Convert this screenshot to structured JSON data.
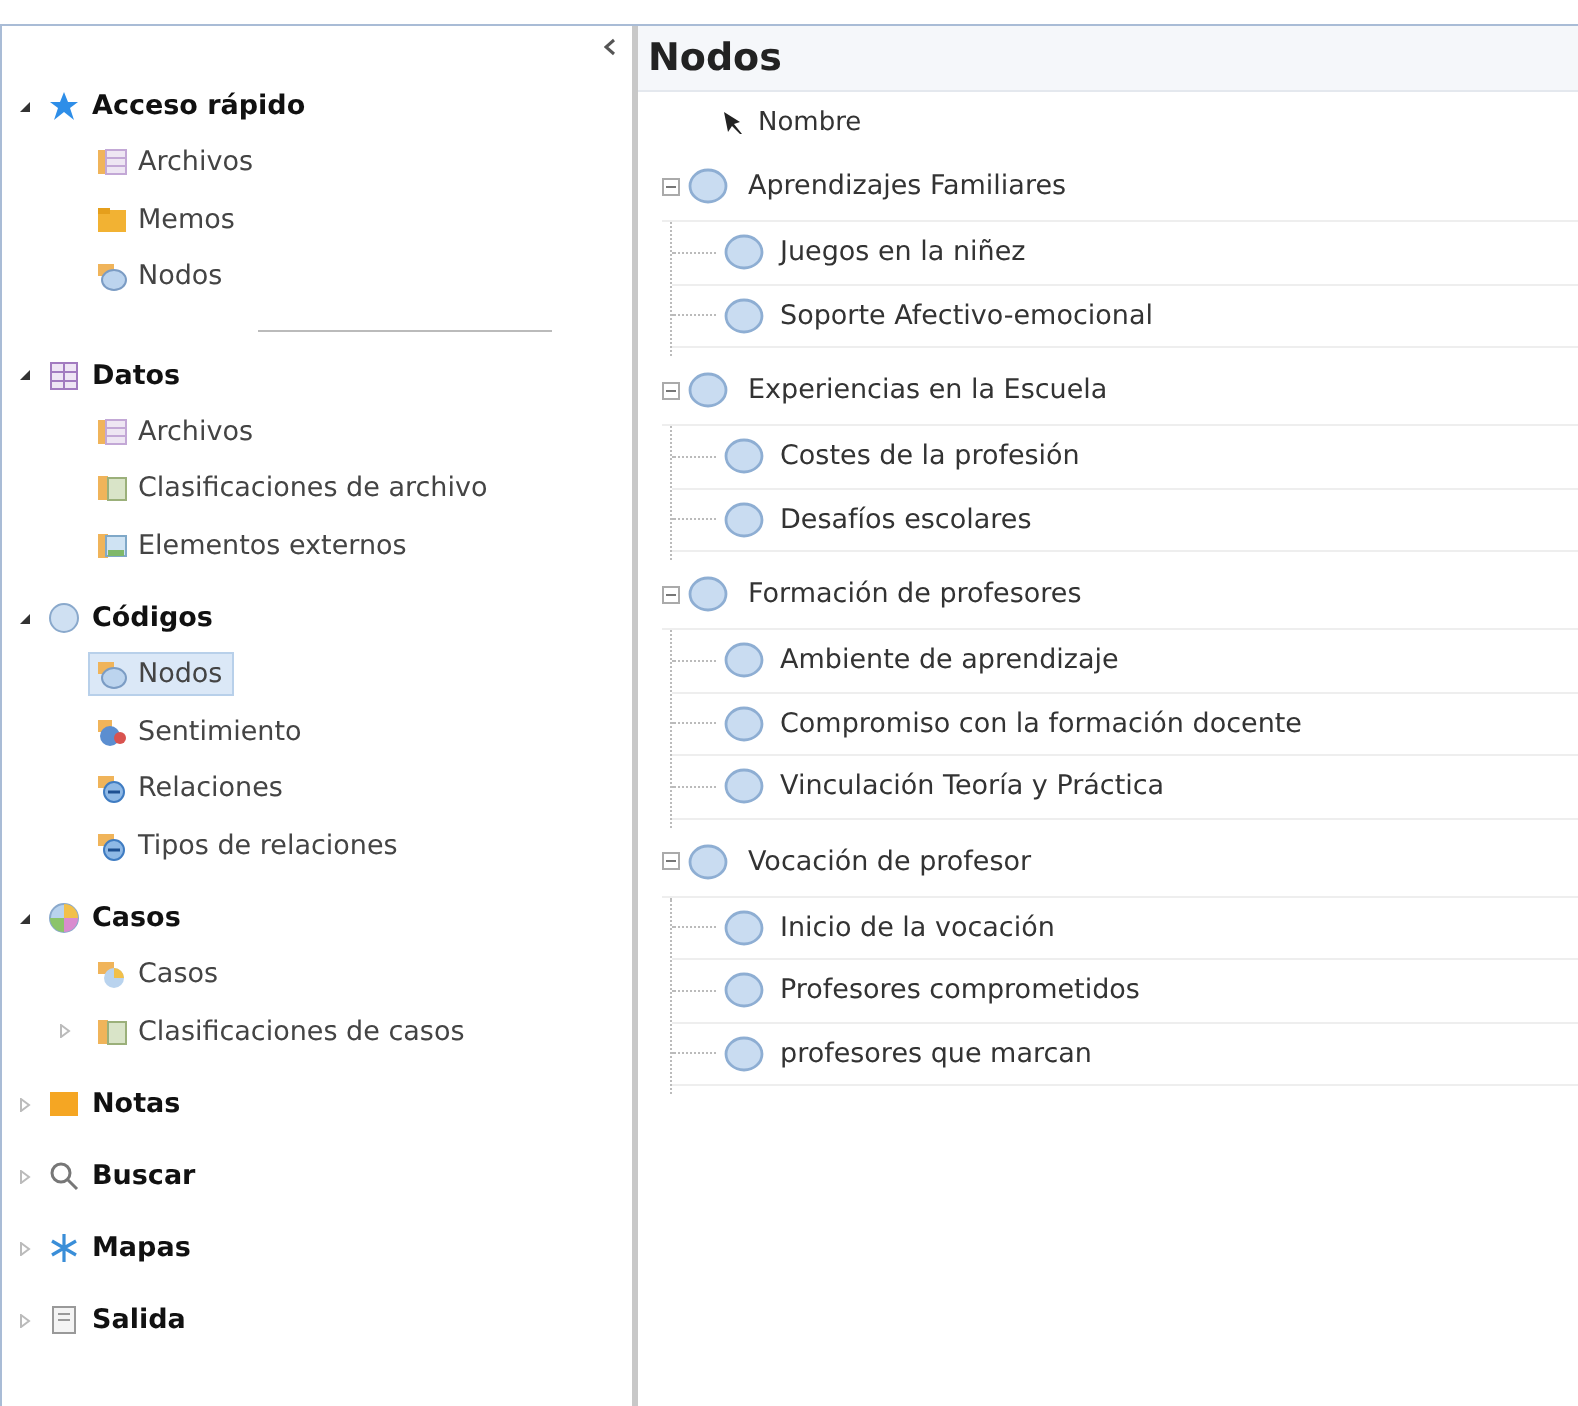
{
  "navigation": {
    "sections": [
      {
        "label": "Acceso rápido",
        "kind": "star",
        "expanded": true,
        "divider": true,
        "items": [
          {
            "label": "Archivos",
            "kind": "files",
            "selected": false
          },
          {
            "label": "Memos",
            "kind": "memo",
            "selected": false
          },
          {
            "label": "Nodos",
            "kind": "nodes",
            "selected": false
          }
        ]
      },
      {
        "label": "Datos",
        "kind": "grid",
        "expanded": true,
        "items": [
          {
            "label": "Archivos",
            "kind": "files",
            "selected": false
          },
          {
            "label": "Clasificaciones de archivo",
            "kind": "classification",
            "selected": false
          },
          {
            "label": "Elementos externos",
            "kind": "external",
            "selected": false
          }
        ]
      },
      {
        "label": "Códigos",
        "kind": "circle",
        "expanded": true,
        "items": [
          {
            "label": "Nodos",
            "kind": "nodes",
            "selected": true
          },
          {
            "label": "Sentimiento",
            "kind": "sentiment",
            "selected": false
          },
          {
            "label": "Relaciones",
            "kind": "relation",
            "selected": false
          },
          {
            "label": "Tipos de relaciones",
            "kind": "relation",
            "selected": false
          }
        ]
      },
      {
        "label": "Casos",
        "kind": "globe",
        "expanded": true,
        "items": [
          {
            "label": "Casos",
            "kind": "cases",
            "selected": false
          },
          {
            "label": "Clasificaciones de casos",
            "kind": "classification",
            "selected": false,
            "expandable": true
          }
        ]
      },
      {
        "label": "Notas",
        "kind": "note",
        "expanded": false
      },
      {
        "label": "Buscar",
        "kind": "search",
        "expanded": false
      },
      {
        "label": "Mapas",
        "kind": "map",
        "expanded": false
      },
      {
        "label": "Salida",
        "kind": "output",
        "expanded": false
      }
    ]
  },
  "content": {
    "title": "Nodos",
    "column": "Nombre",
    "nodes": [
      {
        "label": "Aprendizajes Familiares",
        "expanded": true,
        "children": [
          {
            "label": "Juegos en la niñez"
          },
          {
            "label": "Soporte Afectivo-emocional"
          }
        ]
      },
      {
        "label": "Experiencias en la Escuela",
        "expanded": true,
        "children": [
          {
            "label": "Costes de la profesión"
          },
          {
            "label": "Desafíos escolares"
          }
        ]
      },
      {
        "label": "Formación de profesores",
        "expanded": true,
        "children": [
          {
            "label": "Ambiente de aprendizaje"
          },
          {
            "label": "Compromiso con la formación docente"
          },
          {
            "label": "Vinculación Teoría y Práctica"
          }
        ]
      },
      {
        "label": "Vocación de profesor",
        "expanded": true,
        "children": [
          {
            "label": "Inicio de la vocación"
          },
          {
            "label": "Profesores comprometidos"
          },
          {
            "label": "profesores que marcan"
          }
        ]
      }
    ]
  }
}
